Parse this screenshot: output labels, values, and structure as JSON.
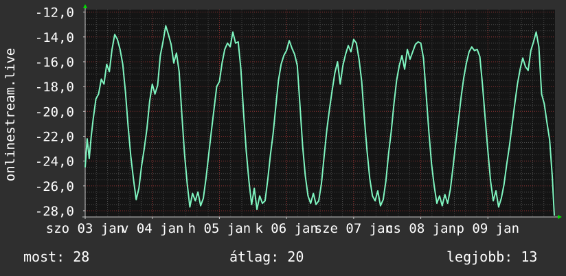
{
  "colors": {
    "background": "#2f2f2f",
    "plot_background": "#141414",
    "grid_minor": "#4a4a4a",
    "grid_major": "#8a2a2a",
    "line": "#7ff5c0",
    "axis_arrow": "#00dd00",
    "text": "#ffffff"
  },
  "stats": {
    "now": "most: 28",
    "avg": "átlag: 20",
    "best": "legjobb: 13"
  },
  "chart_data": {
    "type": "line",
    "ylabel": "onlinestream.live",
    "ylim": [
      -28.5,
      -11.8
    ],
    "y_ticks": [
      -12,
      -14,
      -16,
      -18,
      -20,
      -22,
      -24,
      -26,
      -28
    ],
    "y_tick_labels": [
      "-12,0",
      "-14,0",
      "-16,0",
      "-18,0",
      "-20,0",
      "-22,0",
      "-24,0",
      "-26,0",
      "-28,0"
    ],
    "xlim": [
      0,
      7
    ],
    "x_tick_labels": [
      {
        "x": 0.0,
        "label": "szo 03 jan"
      },
      {
        "x": 1.0,
        "label": "v 04 jan"
      },
      {
        "x": 2.0,
        "label": "h 05 jan"
      },
      {
        "x": 3.0,
        "label": "k 06 jan"
      },
      {
        "x": 4.0,
        "label": "sze 07 jan"
      },
      {
        "x": 5.0,
        "label": "cs 08 jan"
      },
      {
        "x": 6.0,
        "label": "p 09 jan"
      }
    ],
    "grid": true,
    "series": [
      {
        "x": [
          0.0,
          0.03,
          0.06,
          0.09,
          0.12,
          0.16,
          0.2,
          0.24,
          0.28,
          0.32,
          0.36,
          0.4,
          0.44,
          0.48,
          0.52,
          0.56,
          0.6,
          0.64,
          0.68,
          0.72,
          0.76,
          0.8,
          0.84,
          0.88,
          0.92,
          0.96,
          1.0,
          1.04,
          1.08,
          1.12,
          1.16,
          1.2,
          1.24,
          1.28,
          1.32,
          1.36,
          1.4,
          1.44,
          1.48,
          1.52,
          1.56,
          1.6,
          1.64,
          1.68,
          1.72,
          1.76,
          1.8,
          1.84,
          1.88,
          1.92,
          1.96,
          2.0,
          2.04,
          2.08,
          2.12,
          2.16,
          2.2,
          2.24,
          2.28,
          2.32,
          2.36,
          2.4,
          2.44,
          2.48,
          2.52,
          2.56,
          2.6,
          2.64,
          2.68,
          2.72,
          2.76,
          2.8,
          2.84,
          2.88,
          2.92,
          2.96,
          3.0,
          3.04,
          3.08,
          3.12,
          3.16,
          3.2,
          3.24,
          3.28,
          3.32,
          3.36,
          3.4,
          3.44,
          3.48,
          3.52,
          3.56,
          3.6,
          3.64,
          3.68,
          3.72,
          3.76,
          3.8,
          3.84,
          3.88,
          3.92,
          3.96,
          4.0,
          4.04,
          4.08,
          4.12,
          4.16,
          4.2,
          4.24,
          4.28,
          4.32,
          4.36,
          4.4,
          4.44,
          4.48,
          4.52,
          4.56,
          4.6,
          4.64,
          4.68,
          4.72,
          4.76,
          4.8,
          4.84,
          4.88,
          4.92,
          4.96,
          5.0,
          5.04,
          5.08,
          5.12,
          5.16,
          5.2,
          5.24,
          5.28,
          5.32,
          5.36,
          5.4,
          5.44,
          5.48,
          5.52,
          5.56,
          5.6,
          5.64,
          5.68,
          5.72,
          5.76,
          5.8,
          5.84,
          5.88,
          5.92,
          5.96,
          6.0,
          6.04,
          6.08,
          6.12,
          6.16,
          6.2,
          6.24,
          6.28,
          6.32,
          6.36,
          6.4,
          6.44,
          6.48,
          6.52,
          6.56,
          6.6,
          6.64,
          6.68,
          6.72,
          6.76,
          6.8,
          6.84,
          6.88,
          6.92,
          6.96,
          6.99
        ],
        "y": [
          -24.5,
          -22.2,
          -23.8,
          -22.0,
          -20.6,
          -19.0,
          -18.6,
          -17.4,
          -17.8,
          -16.2,
          -16.8,
          -15.0,
          -13.8,
          -14.2,
          -15.0,
          -16.2,
          -18.4,
          -21.2,
          -23.6,
          -25.5,
          -27.1,
          -26.2,
          -24.4,
          -23.0,
          -21.4,
          -19.2,
          -17.8,
          -18.6,
          -17.9,
          -15.5,
          -14.4,
          -13.1,
          -13.8,
          -14.6,
          -16.1,
          -15.3,
          -16.8,
          -20.2,
          -23.4,
          -25.8,
          -27.7,
          -26.6,
          -27.2,
          -26.5,
          -27.6,
          -27.0,
          -25.4,
          -23.5,
          -21.6,
          -19.8,
          -18.0,
          -17.6,
          -16.1,
          -15.0,
          -14.5,
          -14.8,
          -13.6,
          -14.5,
          -14.4,
          -16.6,
          -20.1,
          -23.2,
          -25.6,
          -27.5,
          -26.2,
          -27.9,
          -26.8,
          -27.4,
          -27.2,
          -25.5,
          -23.5,
          -21.8,
          -19.6,
          -17.5,
          -16.2,
          -15.5,
          -15.1,
          -14.3,
          -14.9,
          -15.4,
          -16.3,
          -19.5,
          -22.8,
          -25.2,
          -26.8,
          -27.4,
          -26.6,
          -27.5,
          -27.2,
          -25.8,
          -23.6,
          -21.5,
          -19.8,
          -18.3,
          -16.9,
          -16.0,
          -17.8,
          -16.3,
          -15.4,
          -14.7,
          -15.2,
          -14.2,
          -14.5,
          -15.8,
          -17.6,
          -20.6,
          -23.2,
          -25.4,
          -26.8,
          -27.2,
          -26.4,
          -27.6,
          -27.1,
          -25.6,
          -23.4,
          -21.6,
          -19.4,
          -17.5,
          -16.3,
          -15.5,
          -16.6,
          -15.0,
          -15.8,
          -15.2,
          -14.6,
          -14.4,
          -14.5,
          -15.7,
          -18.6,
          -21.6,
          -24.2,
          -26.0,
          -27.4,
          -26.8,
          -27.6,
          -26.7,
          -27.4,
          -26.3,
          -24.5,
          -22.6,
          -20.8,
          -18.9,
          -17.3,
          -16.1,
          -15.2,
          -14.8,
          -15.1,
          -15.0,
          -15.6,
          -17.9,
          -20.6,
          -23.2,
          -25.6,
          -27.2,
          -26.4,
          -27.7,
          -27.0,
          -25.9,
          -24.3,
          -22.8,
          -21.1,
          -19.4,
          -17.8,
          -16.6,
          -15.7,
          -16.4,
          -16.7,
          -15.1,
          -14.4,
          -13.6,
          -14.8,
          -18.6,
          -19.4,
          -20.9,
          -22.3,
          -25.3,
          -28.4
        ]
      }
    ]
  }
}
